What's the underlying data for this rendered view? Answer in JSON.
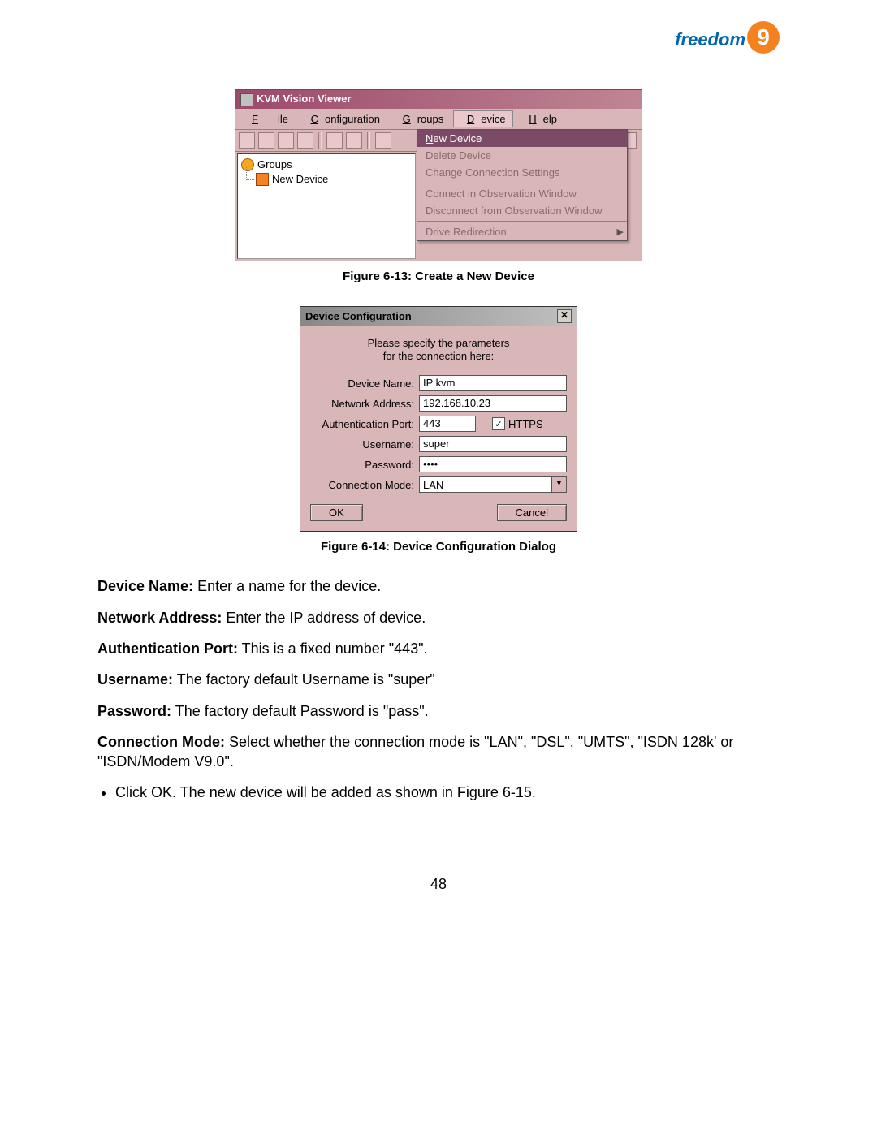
{
  "logo": {
    "text": "freedom",
    "badge": "9"
  },
  "fig13": {
    "window_title": "KVM Vision Viewer",
    "menubar": {
      "file": "File",
      "configuration": "Configuration",
      "groups": "Groups",
      "device": "Device",
      "help": "Help"
    },
    "tree": {
      "root": "Groups",
      "child": "New Device"
    },
    "device_menu": {
      "new_device": "New Device",
      "delete_device": "Delete Device",
      "change_connection": "Change Connection Settings",
      "connect_obs": "Connect in Observation Window",
      "disconnect_obs": "Disconnect from Observation Window",
      "drive_redirection": "Drive Redirection"
    },
    "caption": "Figure 6-13: Create a New Device"
  },
  "fig14": {
    "title": "Device Configuration",
    "msg_line1": "Please specify the parameters",
    "msg_line2": "for the connection here:",
    "labels": {
      "device_name": "Device Name:",
      "network_address": "Network Address:",
      "auth_port": "Authentication Port:",
      "https": "HTTPS",
      "username": "Username:",
      "password": "Password:",
      "conn_mode": "Connection Mode:"
    },
    "values": {
      "device_name": "IP kvm",
      "network_address": "192.168.10.23",
      "auth_port": "443",
      "https_checked": "✓",
      "username": "super",
      "password": "••••",
      "conn_mode": "LAN"
    },
    "buttons": {
      "ok": "OK",
      "cancel": "Cancel"
    },
    "caption": "Figure 6-14: Device Configuration Dialog"
  },
  "body": {
    "device_name_l": "Device Name:",
    "device_name_t": " Enter a name for the device.",
    "network_address_l": "Network Address:",
    "network_address_t": " Enter the IP address of device.",
    "auth_port_l": "Authentication Port:",
    "auth_port_t": " This is a fixed number \"443\".",
    "username_l": "Username:",
    "username_t": " The factory default Username is \"super\"",
    "password_l": "Password:",
    "password_t": " The factory default Password is \"pass\".",
    "conn_mode_l": "Connection Mode:",
    "conn_mode_t": " Select whether the connection mode is \"LAN\", \"DSL\", \"UMTS\", \"ISDN 128k' or \"ISDN/Modem V9.0\".",
    "bullet": "Click OK. The new device will be added as shown in Figure 6-15."
  },
  "page_number": "48"
}
